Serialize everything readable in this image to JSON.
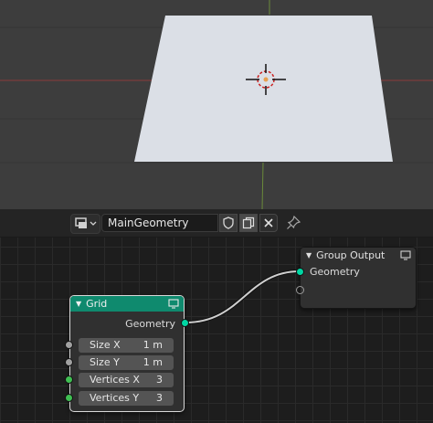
{
  "header": {
    "node_tree_name": "MainGeometry"
  },
  "grid_node": {
    "title": "Grid",
    "output": "Geometry",
    "fields": [
      {
        "label": "Size X",
        "value": "1 m"
      },
      {
        "label": "Size Y",
        "value": "1 m"
      },
      {
        "label": "Vertices X",
        "value": "3"
      },
      {
        "label": "Vertices Y",
        "value": "3"
      }
    ]
  },
  "group_output_node": {
    "title": "Group Output",
    "input": "Geometry"
  },
  "colors": {
    "grid_header": "#0f8a6e",
    "geometry_socket": "#00d6a3",
    "integer_socket": "#3fbf52",
    "value_socket": "#a1a1a1"
  }
}
